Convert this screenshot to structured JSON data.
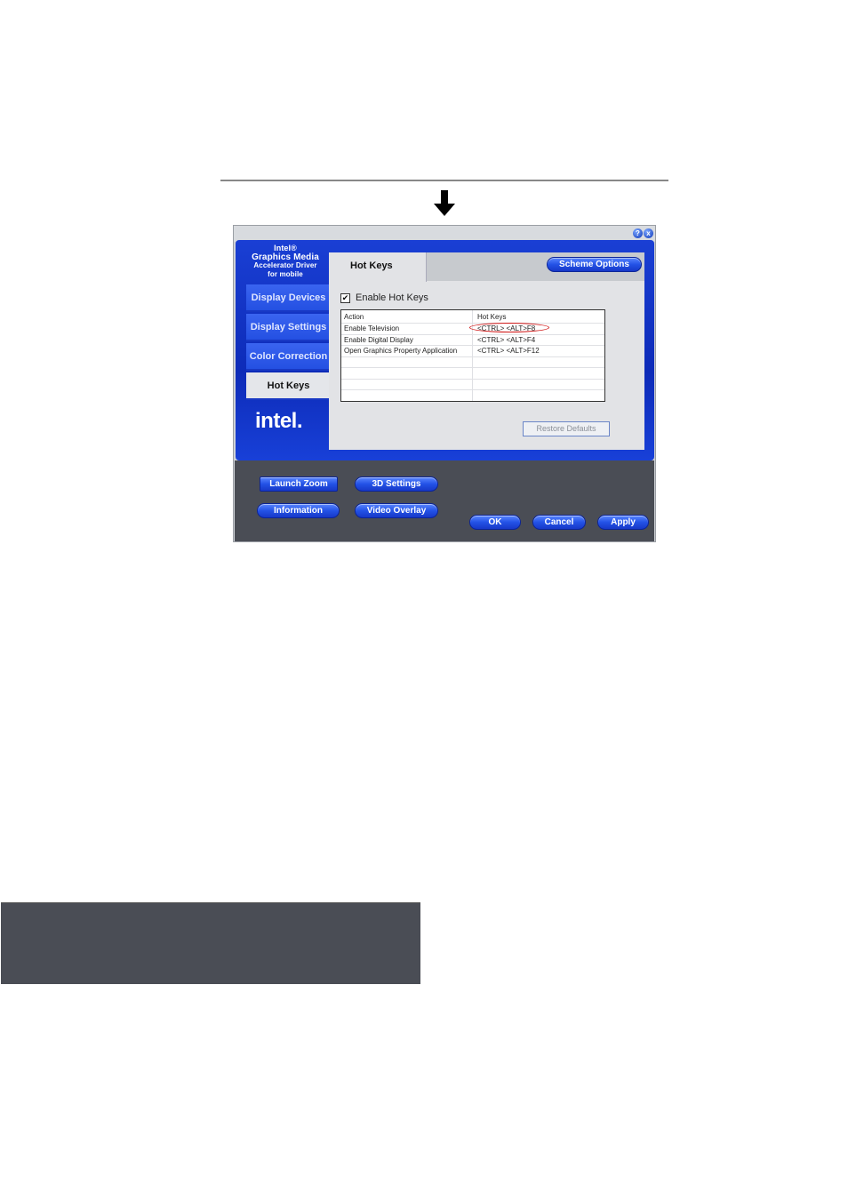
{
  "window": {
    "brand_lines": [
      "Intel®",
      "Graphics Media",
      "Accelerator Driver",
      "for mobile"
    ],
    "help_label": "?",
    "close_label": "x",
    "logo_text": "intel."
  },
  "sidebar": {
    "items": [
      {
        "label": "Display Devices"
      },
      {
        "label": "Display Settings"
      },
      {
        "label": "Color Correction"
      },
      {
        "label": "Hot Keys"
      }
    ]
  },
  "panel": {
    "tab_label": "Hot Keys",
    "scheme_button": "Scheme Options",
    "enable_label": "Enable Hot Keys",
    "enable_checked": true,
    "table": {
      "headers": [
        "Action",
        "Hot Keys"
      ],
      "rows": [
        [
          "Enable Television",
          "<CTRL> <ALT>F8"
        ],
        [
          "Enable Digital Display",
          "<CTRL> <ALT>F4"
        ],
        [
          "Open Graphics Property Application",
          "<CTRL> <ALT>F12"
        ]
      ]
    },
    "restore_button": "Restore Defaults"
  },
  "bottom": {
    "launch_zoom": "Launch Zoom",
    "settings_3d": "3D Settings",
    "information": "Information",
    "video_overlay": "Video Overlay",
    "ok": "OK",
    "cancel": "Cancel",
    "apply": "Apply"
  },
  "colors": {
    "frame_blue": "#0d2bb8",
    "button_blue": "#2352e6",
    "annotation_red": "#d01818"
  }
}
